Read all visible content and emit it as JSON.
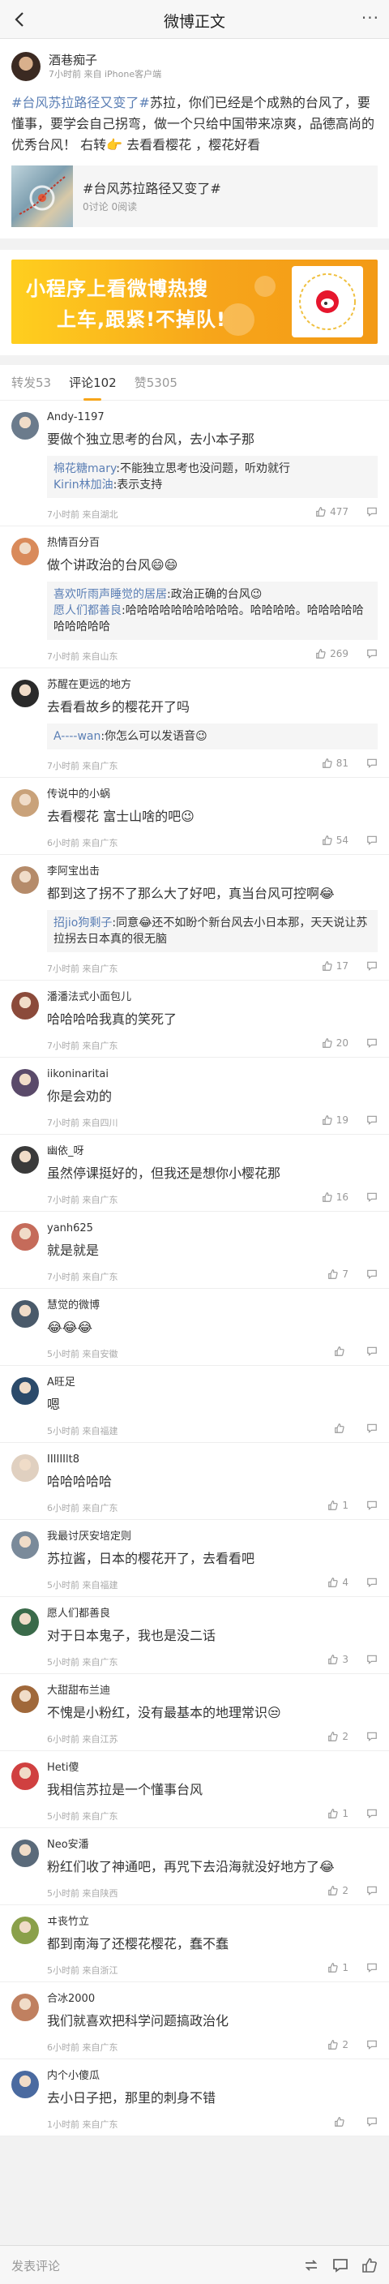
{
  "nav": {
    "title": "微博正文",
    "more": "···"
  },
  "post": {
    "author": "酒巷痴子",
    "meta": "7小时前 来自 iPhone客户端",
    "topic_tag": "#台风苏拉路径又变了#",
    "body": "苏拉，你们已经是个成熟的台风了，要懂事，要学会自己拐弯，做一个只给中国带来凉爽，品德高尚的优秀台风！ 右转👉 去看看樱花 ，樱花好看",
    "card_title": "#台风苏拉路径又变了#",
    "card_stat": "0讨论 0阅读"
  },
  "banner": {
    "line1": "小程序上看微博热搜",
    "line2": "上车,跟紧!不掉队!"
  },
  "tabs": [
    {
      "label": "转发53"
    },
    {
      "label": "评论102"
    },
    {
      "label": "赞5305"
    }
  ],
  "comments": [
    {
      "name": "Andy-1197",
      "text": "要做个独立思考的台风，去小本子那",
      "replies": [
        {
          "name": "棉花糖mary",
          "text": ":不能独立思考也没问题，听劝就行"
        },
        {
          "name": "Kirin林加油",
          "text": ":表示支持"
        }
      ],
      "time": "7小时前 来自湖北",
      "likes": "477"
    },
    {
      "name": "热情百分百",
      "text": "做个讲政治的台风😄😄",
      "replies": [
        {
          "name": "喜欢听雨声睡觉的居居",
          "text": ":政治正确的台风😉"
        },
        {
          "name": "愿人们都善良",
          "text": ":哈哈哈哈哈哈哈哈哈哈。哈哈哈哈。哈哈哈哈哈哈哈哈哈哈"
        }
      ],
      "time": "7小时前 来自山东",
      "likes": "269"
    },
    {
      "name": "苏醒在更远的地方",
      "text": "去看看故乡的樱花开了吗",
      "replies": [
        {
          "name": "A----wan",
          "text": ":你怎么可以发语音😉"
        }
      ],
      "time": "7小时前 来自广东",
      "likes": "81"
    },
    {
      "name": "传说中的小蜗",
      "text": "去看樱花 富士山啥的吧😉",
      "replies": [],
      "time": "6小时前 来自广东",
      "likes": "54"
    },
    {
      "name": "李阿宝出击",
      "text": "都到这了拐不了那么大了好吧，真当台风可控啊😂",
      "replies": [
        {
          "name": "招jio狗剩子",
          "text": ":同意😂还不如盼个新台风去小日本那，天天说让苏拉拐去日本真的很无脑"
        }
      ],
      "time": "7小时前 来自广东",
      "likes": "17"
    },
    {
      "name": "潘潘法式小面包儿",
      "text": "哈哈哈哈我真的笑死了",
      "replies": [],
      "time": "7小时前 来自广东",
      "likes": "20"
    },
    {
      "name": "iikoninaritai",
      "text": "你是会劝的",
      "replies": [],
      "time": "7小时前 来自四川",
      "likes": "19"
    },
    {
      "name": "幽依_呀",
      "text": "虽然停课挺好的，但我还是想你小樱花那",
      "replies": [],
      "time": "7小时前 来自广东",
      "likes": "16"
    },
    {
      "name": "yanh625",
      "text": "就是就是",
      "replies": [],
      "time": "7小时前 来自广东",
      "likes": "7"
    },
    {
      "name": "慧觉的微博",
      "text": "😂😂😂",
      "replies": [],
      "time": "5小时前 来自安徽",
      "likes": ""
    },
    {
      "name": "A旺足",
      "text": "嗯",
      "replies": [],
      "time": "5小时前 来自福建",
      "likes": ""
    },
    {
      "name": "IIIIIIlt8",
      "text": "哈哈哈哈哈",
      "replies": [],
      "time": "6小时前 来自广东",
      "likes": "1"
    },
    {
      "name": "我最讨厌安培定则",
      "text": "苏拉酱，日本的樱花开了，去看看吧",
      "replies": [],
      "time": "5小时前 来自福建",
      "likes": "4"
    },
    {
      "name": "愿人们都善良",
      "text": "对于日本鬼子，我也是没二话",
      "replies": [],
      "time": "5小时前 来自广东",
      "likes": "3"
    },
    {
      "name": "大甜甜布兰迪",
      "text": "不愧是小粉红，没有最基本的地理常识😒",
      "replies": [],
      "time": "6小时前 来自江苏",
      "likes": "2"
    },
    {
      "name": "Heti傻",
      "text": "我相信苏拉是一个懂事台风",
      "replies": [],
      "time": "5小时前 来自广东",
      "likes": "1"
    },
    {
      "name": "Neo安潘",
      "text": "粉红们收了神通吧，再咒下去沿海就没好地方了😂",
      "replies": [],
      "time": "5小时前 来自陕西",
      "likes": "2"
    },
    {
      "name": "ヰ丧竹立",
      "text": "都到南海了还樱花樱花，蠢不蠢",
      "replies": [],
      "time": "5小时前 来自浙江",
      "likes": "1"
    },
    {
      "name": "合冰2000",
      "text": "我们就喜欢把科学问题搞政治化",
      "replies": [],
      "time": "6小时前 来自广东",
      "likes": "2"
    },
    {
      "name": "内个小傻瓜",
      "text": "去小日子把，那里的刺身不错",
      "replies": [],
      "time": "1小时前 来自广东",
      "likes": ""
    }
  ],
  "bottombar": {
    "placeholder": "发表评论"
  },
  "colors": {
    "accent": "#f7a51a",
    "link": "#5b7fb5"
  }
}
